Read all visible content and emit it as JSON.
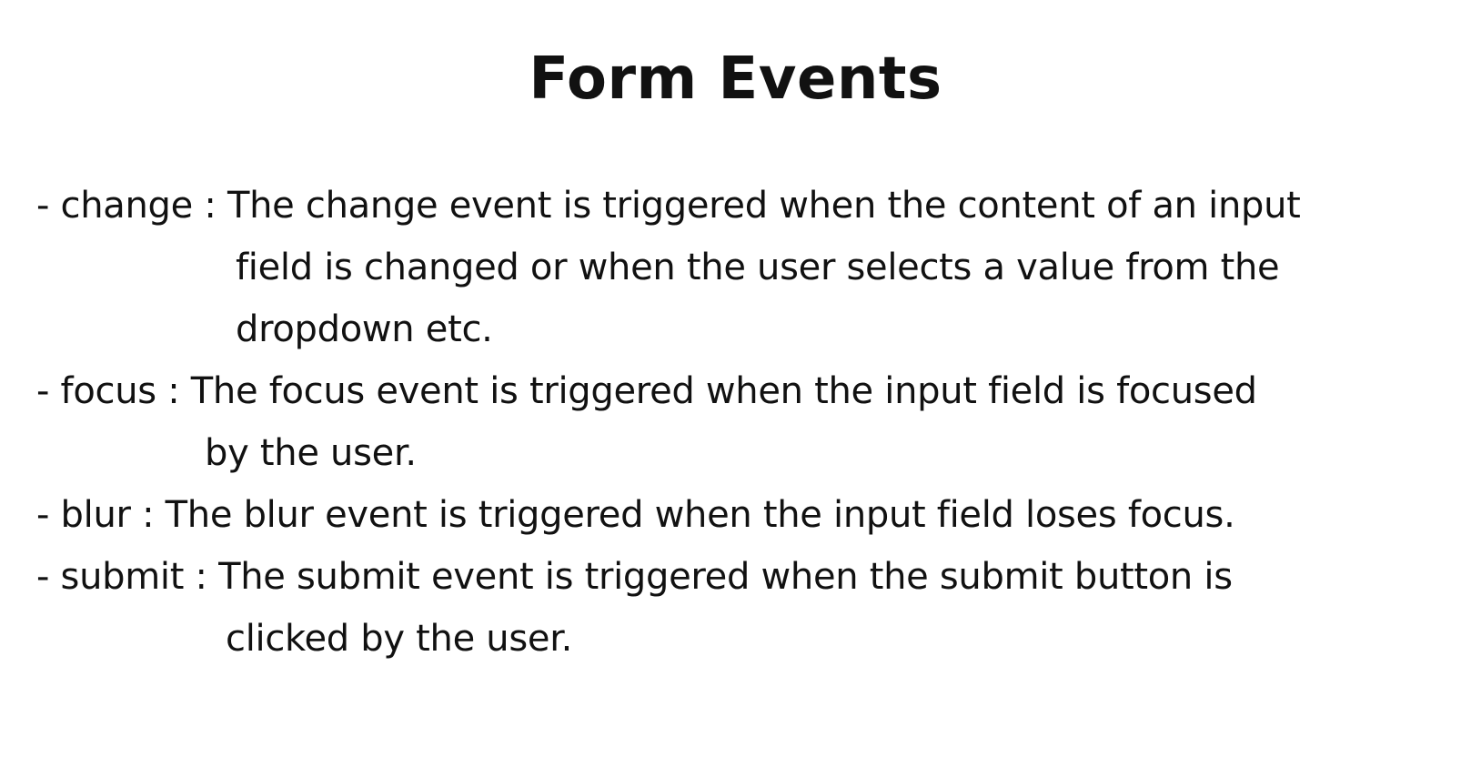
{
  "title": "Form Events",
  "items": [
    {
      "head": "- change : The change event is triggered when the content of an input",
      "continuation": [
        "field is changed or when the user selects a value from the",
        "dropdown etc."
      ]
    },
    {
      "head": "- focus : The focus event is triggered when the input field is focused",
      "continuation": [
        "by the user."
      ]
    },
    {
      "head": "- blur : The blur event is triggered when the input field loses focus.",
      "continuation": []
    },
    {
      "head": "- submit : The submit event is triggered when the submit button is",
      "continuation": [
        "clicked by the user."
      ]
    }
  ]
}
